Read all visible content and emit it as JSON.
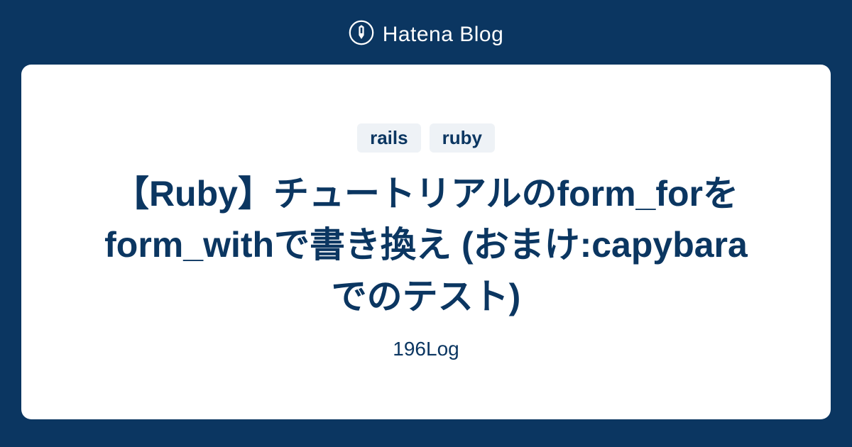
{
  "header": {
    "brand": "Hatena Blog"
  },
  "card": {
    "tags": [
      "rails",
      "ruby"
    ],
    "title": "【Ruby】チュートリアルのform_forをform_withで書き換え (おまけ:capybaraでのテスト)",
    "blog_name": "196Log"
  }
}
